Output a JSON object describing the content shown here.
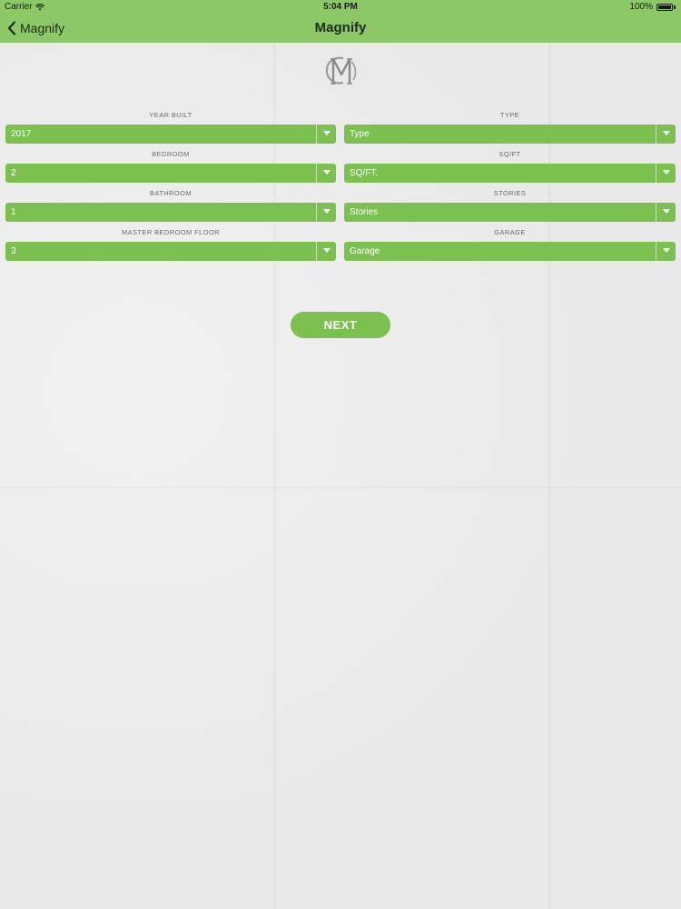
{
  "status_bar": {
    "carrier": "Carrier",
    "time": "5:04 PM",
    "battery": "100%"
  },
  "nav": {
    "back_label": "Magnify",
    "title": "Magnify"
  },
  "logo": {
    "icon": "cm-monogram-logo"
  },
  "form": {
    "year_built": {
      "label": "YEAR BUILT",
      "value": "2017"
    },
    "type": {
      "label": "TYPE",
      "value": "Type"
    },
    "bedroom": {
      "label": "BEDROOM",
      "value": "2"
    },
    "sqft": {
      "label": "SQ/FT",
      "value": "SQ/FT."
    },
    "bathroom": {
      "label": "BATHROOM",
      "value": "1"
    },
    "stories": {
      "label": "STORIES",
      "value": "Stories"
    },
    "master_bedroom_floor": {
      "label": "MASTER BEDROOM FLOOR",
      "value": "3"
    },
    "garage": {
      "label": "GARAGE",
      "value": "Garage"
    }
  },
  "next_button": {
    "label": "NEXT"
  },
  "colors": {
    "accent": "#7cc04f",
    "nav_bar": "#8cc865",
    "background": "#e9e9e9"
  }
}
